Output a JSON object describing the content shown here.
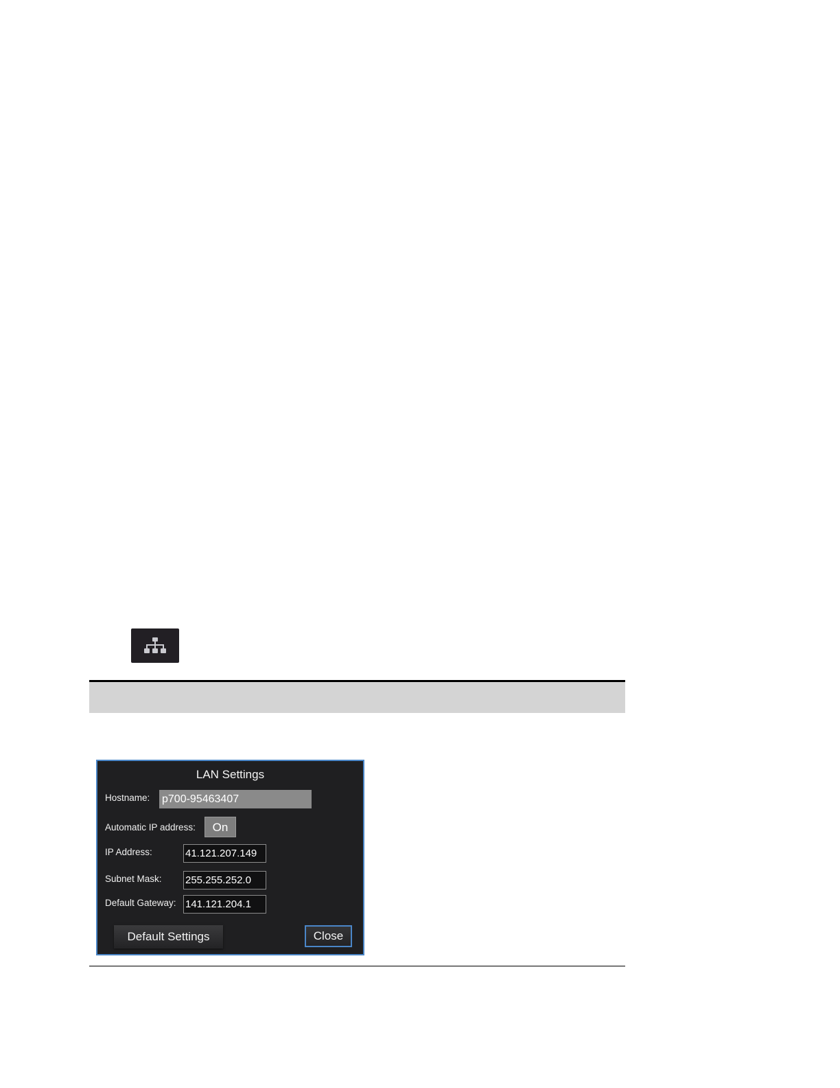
{
  "network_icon": {
    "icon": "network-icon"
  },
  "dialog": {
    "title": "LAN Settings",
    "hostname": {
      "label": "Hostname:",
      "value": "p700-95463407"
    },
    "auto_ip": {
      "label": "Automatic IP address:",
      "value": "On"
    },
    "ip_address": {
      "label": "IP Address:",
      "value": "41.121.207.149"
    },
    "subnet_mask": {
      "label": "Subnet Mask:",
      "value": "255.255.252.0"
    },
    "default_gateway": {
      "label": "Default Gateway:",
      "value": "141.121.204.1"
    },
    "buttons": {
      "default_settings": "Default Settings",
      "close": "Close"
    }
  },
  "colors": {
    "dialog_background": "#1f1f21",
    "dialog_border": "#4a86c8",
    "table_header_band": "#d4d4d4"
  }
}
